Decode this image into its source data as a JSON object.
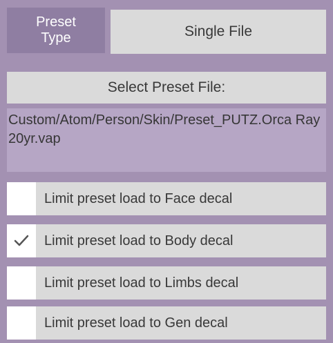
{
  "preset_type": {
    "label": "Preset\nType",
    "value": "Single File"
  },
  "select_file": {
    "label": "Select Preset File:"
  },
  "file_path": {
    "value": "Custom/Atom/Person/Skin/Preset_PUTZ.Orca Ray 20yr.vap"
  },
  "toggles": [
    {
      "label": "Limit preset load to Face decal",
      "checked": false
    },
    {
      "label": "Limit preset load to Body decal",
      "checked": true
    },
    {
      "label": "Limit preset load to Limbs decal",
      "checked": false
    },
    {
      "label": "Limit preset load to Gen decal",
      "checked": false
    }
  ],
  "colors": {
    "panel_bg": "#a391b2",
    "label_bg": "#8f7ea2",
    "button_bg": "#dadada",
    "text_field_bg": "#b6a6c5",
    "checkbox_bg": "#ffffff",
    "checkmark": "#555555"
  }
}
